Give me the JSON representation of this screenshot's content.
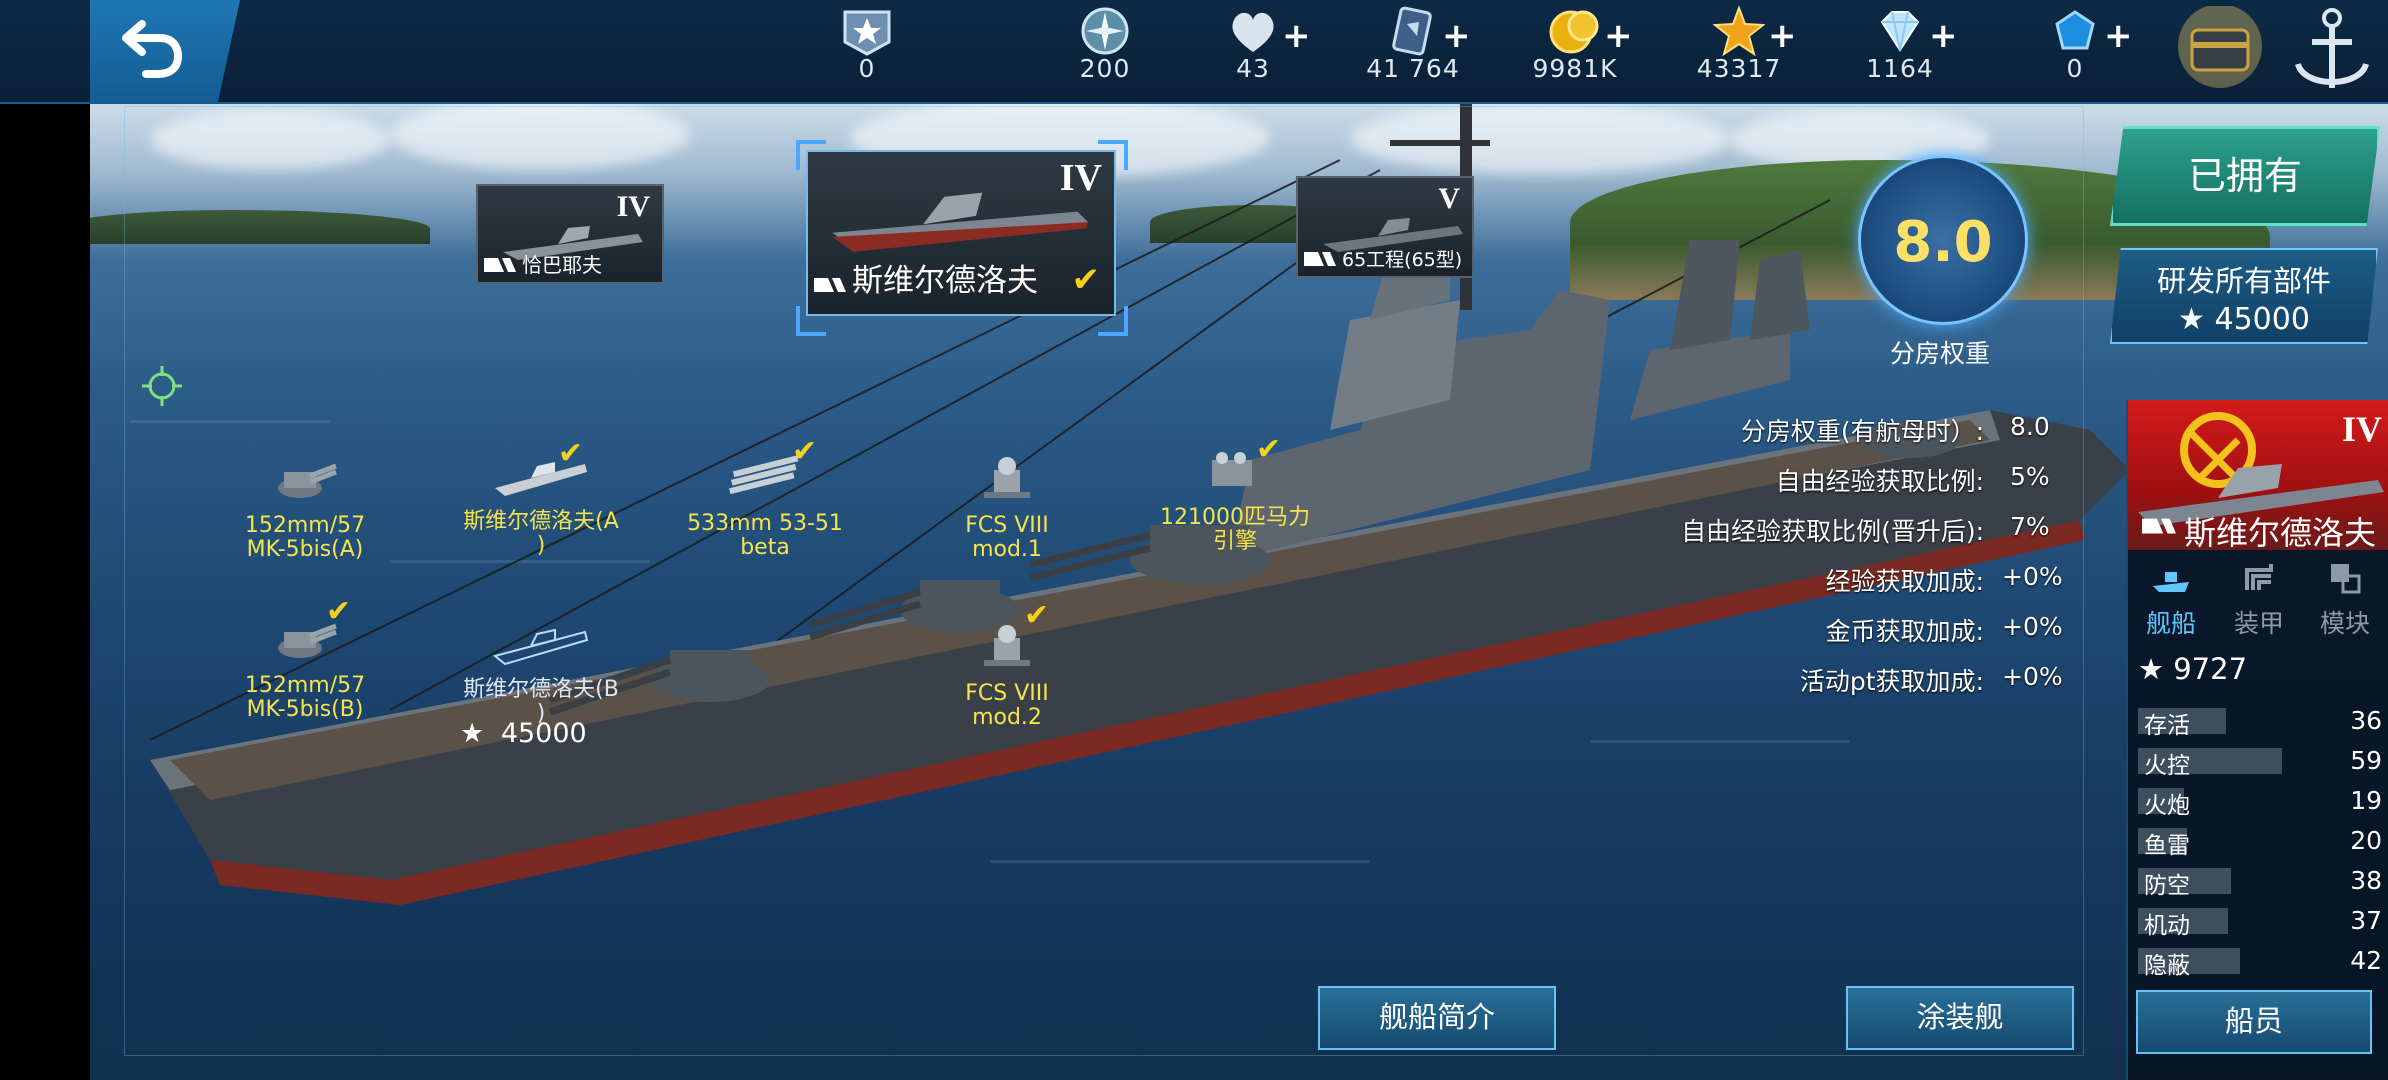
{
  "topbar": {
    "back_label": "back",
    "resources": [
      {
        "name": "rank-icon",
        "value": "0",
        "plus": false
      },
      {
        "name": "compass-icon",
        "value": "200",
        "plus": false
      },
      {
        "name": "heart-icon",
        "value": "43",
        "plus": true
      },
      {
        "name": "card-icon",
        "value": "41 764",
        "plus": true
      },
      {
        "name": "coin-icon",
        "value": "9981K",
        "plus": true
      },
      {
        "name": "star-icon",
        "value": "43317",
        "plus": true
      },
      {
        "name": "diamond-icon",
        "value": "1164",
        "plus": true
      },
      {
        "name": "gem-icon",
        "value": "0",
        "plus": true
      }
    ]
  },
  "ship_cards": [
    {
      "tier": "IV",
      "name": "恰巴耶夫"
    },
    {
      "tier": "IV",
      "name": "斯维尔德洛夫"
    },
    {
      "tier": "V",
      "name": "65工程(65型)"
    }
  ],
  "modules": [
    {
      "label": "152mm/57\nMK-5bis(A)"
    },
    {
      "label": "斯维尔德洛夫(A\n)"
    },
    {
      "label": "533mm 53-51\nbeta"
    },
    {
      "label": "FCS VIII\nmod.1"
    },
    {
      "label": "121000匹马力\n引擎"
    },
    {
      "label": "152mm/57\nMK-5bis(B)"
    },
    {
      "label": "斯维尔德洛夫(B\n)"
    },
    {
      "label": "FCS VIII\nmod.2"
    }
  ],
  "research_cost": "45000",
  "weight": {
    "value": "8.0",
    "label": "分房权重"
  },
  "stats": [
    {
      "k": "分房权重(有航母时）:",
      "v": "8.0"
    },
    {
      "k": "自由经验获取比例:",
      "v": "5%"
    },
    {
      "k": "自由经验获取比例(晋升后):",
      "v": "7%"
    },
    {
      "k": "经验获取加成:",
      "v": "+0%"
    },
    {
      "k": "金币获取加成:",
      "v": "+0%"
    },
    {
      "k": "活动pt获取加成:",
      "v": "+0%"
    }
  ],
  "buttons": {
    "owned": "已拥有",
    "research_all": "研发所有部件",
    "research_all_cost": "45000",
    "ship_intro": "舰船简介",
    "paint": "涂装舰",
    "crew": "船员"
  },
  "right_panel": {
    "tier": "IV",
    "name": "斯维尔德洛夫",
    "tabs": [
      "舰船",
      "装甲",
      "模块"
    ],
    "points": "9727",
    "attributes": [
      {
        "label": "存活",
        "value": "36",
        "fill": 0.36
      },
      {
        "label": "火控",
        "value": "59",
        "fill": 0.59
      },
      {
        "label": "火炮",
        "value": "19",
        "fill": 0.19
      },
      {
        "label": "鱼雷",
        "value": "20",
        "fill": 0.2
      },
      {
        "label": "防空",
        "value": "38",
        "fill": 0.38
      },
      {
        "label": "机动",
        "value": "37",
        "fill": 0.37
      },
      {
        "label": "隐蔽",
        "value": "42",
        "fill": 0.42
      }
    ]
  },
  "colors": {
    "accent": "#66c2f2",
    "highlight": "#f7e34a",
    "owned": "#2ca08e"
  }
}
